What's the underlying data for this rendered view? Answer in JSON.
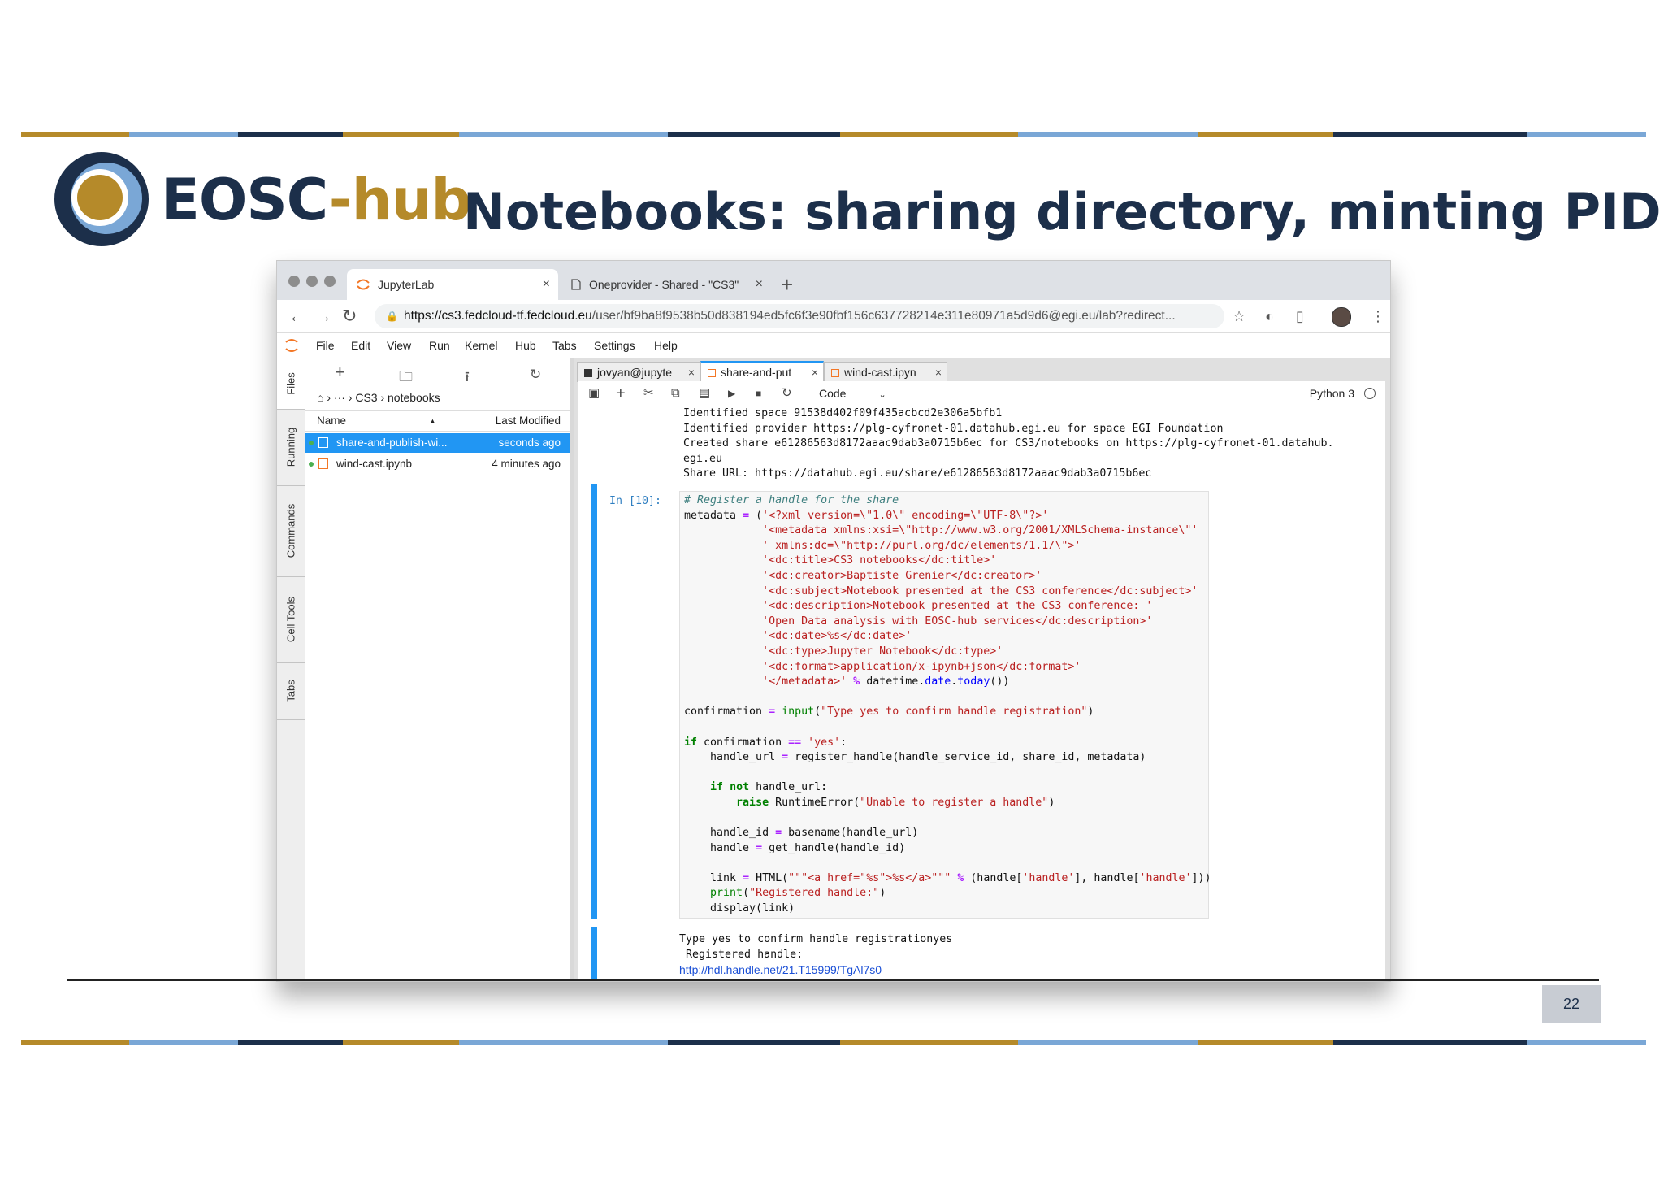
{
  "slide": {
    "logo_part1": "EOSC",
    "logo_part2": "-hub",
    "title": "Notebooks: sharing directory, minting PID",
    "page_number": "22",
    "colors": {
      "navy": "#1c2f4a",
      "gold": "#b58a2a",
      "light_blue": "#7aa7d6"
    }
  },
  "browser": {
    "tabs": [
      {
        "label": "JupyterLab",
        "close": "×"
      },
      {
        "label": "Oneprovider - Shared - \"CS3\"",
        "close": "×"
      }
    ],
    "new_tab": "+",
    "url_host": "https://cs3.fedcloud-tf.fedcloud.eu",
    "url_path": "/user/bf9ba8f9538b50d838194ed5fc6f3e90fbf156c637728214e311e80971a5d9d6@egi.eu/lab?redirect...",
    "icons": [
      "back-arrow-icon",
      "forward-arrow-icon",
      "reload-icon",
      "lock-icon",
      "star-icon",
      "extension-icon",
      "bookmark-icon",
      "avatar",
      "more-icon"
    ]
  },
  "jupyter": {
    "menu": [
      "File",
      "Edit",
      "View",
      "Run",
      "Kernel",
      "Hub",
      "Tabs",
      "Settings",
      "Help"
    ],
    "sidebar_tabs": [
      "Files",
      "Running",
      "Commands",
      "Cell Tools",
      "Tabs"
    ],
    "breadcrumb": "› ··· › CS3 › notebooks",
    "file_header": {
      "name": "Name",
      "modified": "Last Modified"
    },
    "files": [
      {
        "name": "share-and-publish-wi...",
        "modified": "seconds ago",
        "selected": true
      },
      {
        "name": "wind-cast.ipynb",
        "modified": "4 minutes ago",
        "selected": false
      }
    ],
    "doc_tabs": [
      {
        "label": "jovyan@jupyte",
        "close": "×"
      },
      {
        "label": "share-and-put",
        "close": "×"
      },
      {
        "label": "wind-cast.ipyn",
        "close": "×"
      }
    ],
    "cell_type": "Code",
    "kernel_name": "Python 3",
    "prev_output": "Identified space 91538d402f09f435acbcd2e306a5bfb1\nIdentified provider https://plg-cyfronet-01.datahub.egi.eu for space EGI Foundation\nCreated share e61286563d8172aaac9dab3a0715b6ec for CS3/notebooks on https://plg-cyfronet-01.datahub.\negi.eu\nShare URL: https://datahub.egi.eu/share/e61286563d8172aaac9dab3a0715b6ec",
    "prompt": "In [10]:",
    "code_lines": [
      "# Register a handle for the share",
      "metadata = ('<?xml version=\\\"1.0\\\" encoding=\\\"UTF-8\\\"?>'",
      "            '<metadata xmlns:xsi=\\\"http://www.w3.org/2001/XMLSchema-instance\\\"'",
      "            ' xmlns:dc=\\\"http://purl.org/dc/elements/1.1/\\\">'",
      "            '<dc:title>CS3 notebooks</dc:title>'",
      "            '<dc:creator>Baptiste Grenier</dc:creator>'",
      "            '<dc:subject>Notebook presented at the CS3 conference</dc:subject>'",
      "            '<dc:description>Notebook presented at the CS3 conference: '",
      "            'Open Data analysis with EOSC-hub services</dc:description>'",
      "            '<dc:date>%s</dc:date>'",
      "            '<dc:type>Jupyter Notebook</dc:type>'",
      "            '<dc:format>application/x-ipynb+json</dc:format>'",
      "            '</metadata>' % datetime.date.today())",
      "",
      "confirmation = input(\"Type yes to confirm handle registration\")",
      "",
      "if confirmation == 'yes':",
      "    handle_url = register_handle(handle_service_id, share_id, metadata)",
      "",
      "    if not handle_url:",
      "        raise RuntimeError(\"Unable to register a handle\")",
      "",
      "    handle_id = basename(handle_url)",
      "    handle = get_handle(handle_id)",
      "",
      "    link = HTML(\"\"\"<a href=\"%s\">%s</a>\"\"\" % (handle['handle'], handle['handle']))",
      "    print(\"Registered handle:\")",
      "    display(link)"
    ],
    "output_text": "Type yes to confirm handle registrationyes\n Registered handle:",
    "output_link": "http://hdl.handle.net/21.T15999/TgAl7s0"
  }
}
